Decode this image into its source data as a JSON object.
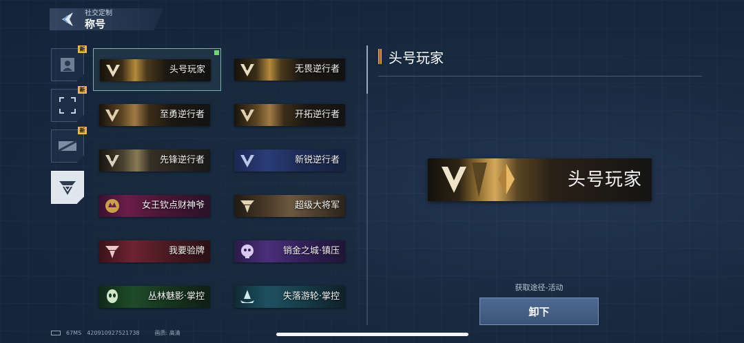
{
  "header": {
    "subtitle": "社交定制",
    "title": "称号"
  },
  "categories": [
    {
      "icon": "avatar-icon",
      "badge": "新",
      "active": false
    },
    {
      "icon": "frame-icon",
      "badge": "新",
      "active": false
    },
    {
      "icon": "card-icon",
      "badge": "新",
      "active": false
    },
    {
      "icon": "title-badge-icon",
      "badge": "",
      "active": true
    }
  ],
  "titles": [
    {
      "name": "头号玩家",
      "style": "gold",
      "selected": true
    },
    {
      "name": "无畏逆行者",
      "style": "gold",
      "selected": false
    },
    {
      "name": "至勇逆行者",
      "style": "bronze",
      "selected": false
    },
    {
      "name": "开拓逆行者",
      "style": "bronze",
      "selected": false
    },
    {
      "name": "先锋逆行者",
      "style": "silver",
      "selected": false
    },
    {
      "name": "新锐逆行者",
      "style": "blue",
      "selected": false
    },
    {
      "name": "女王钦点财神爷",
      "style": "magenta",
      "selected": false
    },
    {
      "name": "超级大将军",
      "style": "sepia",
      "selected": false
    },
    {
      "name": "我要验牌",
      "style": "red",
      "selected": false
    },
    {
      "name": "销金之城·镇压",
      "style": "purple",
      "selected": false
    },
    {
      "name": "丛林魅影·掌控",
      "style": "green",
      "selected": false
    },
    {
      "name": "失落游轮·掌控",
      "style": "teal",
      "selected": false
    }
  ],
  "detail": {
    "title": "头号玩家",
    "banner_label": "头号玩家",
    "source": "获取途径-活动",
    "action_button": "卸下"
  },
  "footer": {
    "ping": "67MS",
    "uid": "420910927521738",
    "quality": "画质: 高清"
  },
  "colors": {
    "accent_gold": "#e0a437",
    "selected_border": "#7fb3a8",
    "new_badge": "#f0b93a",
    "button_blue": "#4e6a92"
  }
}
